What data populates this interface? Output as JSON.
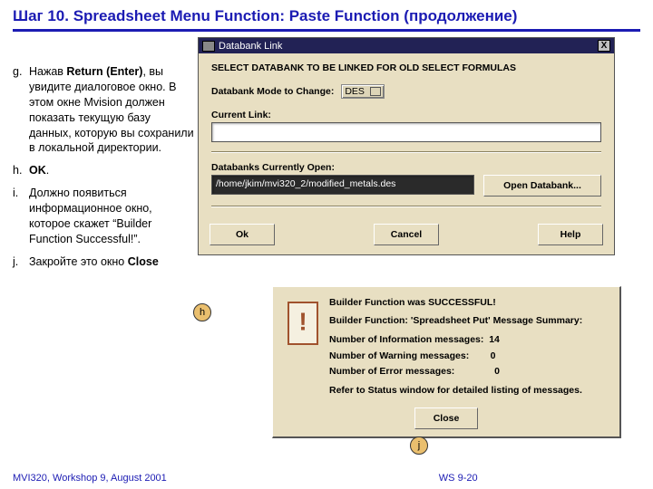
{
  "title": "Шаг 10.  Spreadsheet Menu Function:  Paste Function (продолжение)",
  "instructions": [
    {
      "marker": "g.",
      "html": "Нажав <b>Return (Enter)</b>, вы увидите диалоговое окно. В этом окне Mvision должен показать текущую базу данных, которую вы сохранили в локальной директории."
    },
    {
      "marker": "h.",
      "html": "<b>OK</b>."
    },
    {
      "marker": "i.",
      "html": "Должно появиться информационное окно, которое скажет “Builder Function Successful!”."
    },
    {
      "marker": "j.",
      "html": "Закройте это окно <b>Close</b>"
    }
  ],
  "callout_h": "h",
  "callout_j": "j",
  "dlg1": {
    "title": "Databank Link",
    "close": "X",
    "header": "SELECT DATABANK TO BE LINKED FOR OLD SELECT FORMULAS",
    "mode_label": "Databank Mode to Change:",
    "mode_value": "DES",
    "current_link_label": "Current Link:",
    "currently_open_label": "Databanks Currently Open:",
    "open_path": "/home/jkim/mvi320_2/modified_metals.des",
    "open_btn": "Open Databank...",
    "buttons": {
      "ok": "Ok",
      "cancel": "Cancel",
      "help": "Help"
    }
  },
  "dlg2": {
    "bang": "!",
    "line1": "Builder Function was SUCCESSFUL!",
    "line2": "Builder Function:  'Spreadsheet Put'  Message Summary:",
    "info_label": "Number of Information messages:",
    "info_count": "14",
    "warn_label": "Number of Warning messages:",
    "warn_count": "0",
    "err_label": "Number of Error messages:",
    "err_count": "0",
    "refer": "Refer to Status window for detailed listing of messages.",
    "close": "Close"
  },
  "footer": {
    "left": "MVI320, Workshop 9, August 2001",
    "slide": "WS 9-20"
  }
}
